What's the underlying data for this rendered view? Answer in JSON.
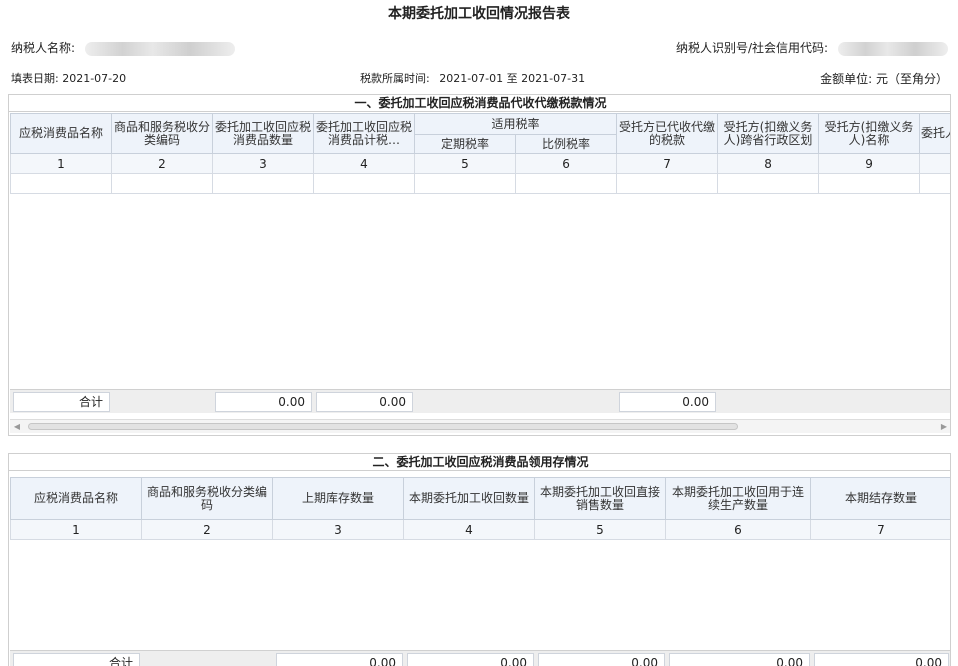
{
  "report": {
    "title": "本期委托加工收回情况报告表",
    "taxpayer_name_label": "纳税人名称:",
    "taxpayer_id_label": "纳税人识别号/社会信用代码:",
    "fill_date": "填表日期: 2021-07-20",
    "period_label": "税款所属时间:",
    "period_value": "2021-07-01 至 2021-07-31",
    "amount_unit": "金额单位: 元（至角分）"
  },
  "section1": {
    "title": "一、委托加工收回应税消费品代收代缴税款情况",
    "headers": {
      "col1": "应税消费品名称",
      "col2": "商品和服务税收分类编码",
      "col3": "委托加工收回应税消费品数量",
      "col4": "委托加工收回应税消费品计税…",
      "rate_group": "适用税率",
      "col5": "定期税率",
      "col6": "比例税率",
      "col7": "受托方已代收代缴的税款",
      "col8": "受托方(扣缴义务人)跨省行政区划",
      "col9": "受托方(扣缴义务人)名称",
      "col10": "委托人"
    },
    "col_numbers": [
      "1",
      "2",
      "3",
      "4",
      "5",
      "6",
      "7",
      "8",
      "9",
      ""
    ],
    "total_label": "合计",
    "total_qty": "0.00",
    "total_taxbase": "0.00",
    "total_tax": "0.00"
  },
  "section2": {
    "title": "二、委托加工收回应税消费品领用存情况",
    "headers": {
      "col1": "应税消费品名称",
      "col2": "商品和服务税收分类编码",
      "col3": "上期库存数量",
      "col4": "本期委托加工收回数量",
      "col5": "本期委托加工收回直接销售数量",
      "col6": "本期委托加工收回用于连续生产数量",
      "col7": "本期结存数量"
    },
    "col_numbers": [
      "1",
      "2",
      "3",
      "4",
      "5",
      "6",
      "7"
    ],
    "total_label": "合计",
    "total_prev": "0.00",
    "total_recv": "0.00",
    "total_sold": "0.00",
    "total_prod": "0.00",
    "total_end": "0.00"
  },
  "scrollbar": {
    "left_arrow": "◀",
    "right_arrow": "▶"
  }
}
